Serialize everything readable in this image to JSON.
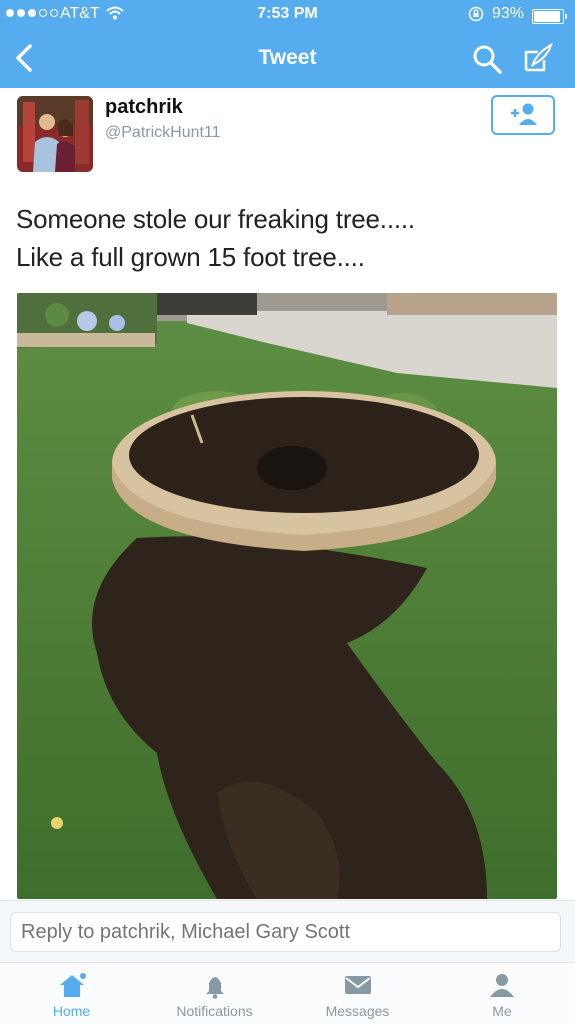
{
  "status_bar": {
    "carrier": "AT&T",
    "time": "7:53 PM",
    "battery_percent": "93%"
  },
  "nav": {
    "title": "Tweet"
  },
  "tweet": {
    "display_name": "patchrik",
    "handle": "@PatrickHunt11",
    "text_line1": "Someone stole our freaking tree.....",
    "text_line2": "Like a full grown 15 foot tree...."
  },
  "reply": {
    "placeholder": "Reply to patchrik, Michael Gary Scott"
  },
  "tabs": [
    {
      "label": "Home",
      "active": true
    },
    {
      "label": "Notifications",
      "active": false
    },
    {
      "label": "Messages",
      "active": false
    },
    {
      "label": "Me",
      "active": false
    }
  ],
  "colors": {
    "brand": "#55acee",
    "muted": "#8899a6"
  }
}
